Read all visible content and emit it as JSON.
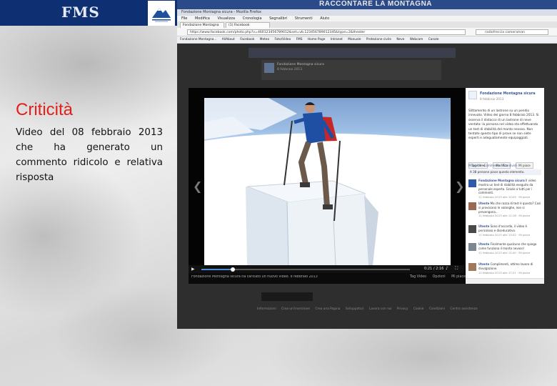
{
  "slide": {
    "logo_text": "FMS",
    "header_title": "RACCONTARE LA MONTAGNA",
    "criticita_title": "Criticità",
    "criticita_body": "Video del 08 febbraio 2013 che ha generato un commento ridicolo e relativa risposta"
  },
  "browser": {
    "window_title": "Fondazione Montagna sicura - Mozilla Firefox",
    "menu": [
      "File",
      "Modifica",
      "Visualizza",
      "Cronologia",
      "Segnalibri",
      "Strumenti",
      "Aiuto"
    ],
    "tabs": [
      {
        "label": "Fondazione Montagna sicura"
      },
      {
        "label": "(1) Facebook"
      }
    ],
    "url": "https://www.facebook.com/photo.php?v=460123456789012&set=vb.123456789012345&type=2&theater",
    "search_placeholder": "radiofreccia cameraman",
    "bookmarks": [
      "Fondazione Montagna...",
      "AllAbout",
      "Facebook",
      "Meteo",
      "Foto/Video",
      "FMS",
      "Home Page",
      "Intranet",
      "Manuale",
      "Protezione civile",
      "Neve",
      "Webcam",
      "Canale"
    ]
  },
  "facebook": {
    "page_name": "Fondazione Montagna sicura",
    "post_time": "8 febbraio 2013",
    "viewer": {
      "timecode": "0:21 / 2:16",
      "caption": "Fondazione Montagna sicura ha caricato un nuovo video. 8 febbraio 2013",
      "links": [
        "Tag Video",
        "Opzioni",
        "Mi piace"
      ],
      "progress_fraction": 0.15
    },
    "sidebar": {
      "page_name": "Fondazione Montagna sicura",
      "date": "8 febbraio 2013",
      "description": "Slittamento di un lastrone su un pendio innevato. Video del giorno 8 febbraio 2013. Si osserva il distacco di un lastrone di neve ventata: la persona nel video sta effettuando un test di stabilità del manto nevoso. Non tentate questo tipo di prove se non siete esperti e adeguatamente equipaggiati.",
      "actions": [
        "Tag Video",
        "Modifica",
        "Mi piace"
      ],
      "stats": "Mi piace · Commenta · Condividi",
      "likes": "A 38 persone piace questo elemento.",
      "comments": [
        {
          "author": "Fondazione Montagna sicura",
          "text": "Il video mostra un test di stabilità eseguito da personale esperto. Grazie a tutti per i commenti.",
          "meta": "11 febbraio 2013 alle 10:05 · Mi piace"
        },
        {
          "author": "Utente",
          "text": "Ma che razza di test è questo? Così si provocano le valanghe, non si prevengono...",
          "meta": "11 febbraio 2013 alle 12:18 · Mi piace"
        },
        {
          "author": "Utente",
          "text": "Sono d'accordo, il video è pericoloso e diseducativo.",
          "meta": "11 febbraio 2013 alle 13:02 · Mi piace"
        },
        {
          "author": "Utente",
          "text": "Finalmente qualcuno che spiega come funziona il manto nevoso!",
          "meta": "11 febbraio 2013 alle 15:40 · Mi piace"
        },
        {
          "author": "Utente",
          "text": "Complimenti, ottimo lavoro di divulgazione.",
          "meta": "11 febbraio 2013 alle 17:21 · Mi piace"
        }
      ]
    },
    "footer_links": [
      "Informazioni",
      "Crea un'inserzione",
      "Crea una Pagina",
      "Sviluppatori",
      "Lavora con noi",
      "Privacy",
      "Cookie",
      "Condizioni",
      "Centro assistenza"
    ]
  }
}
